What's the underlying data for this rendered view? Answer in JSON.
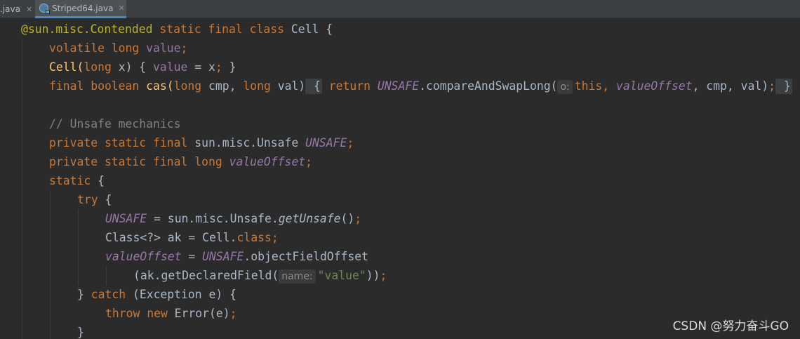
{
  "tabs": [
    {
      "label": ".java",
      "active": false
    },
    {
      "label": "Striped64.java",
      "active": true
    }
  ],
  "code": {
    "line1": {
      "annotation": "@sun.misc.Contended",
      "kw": " static final class",
      "rest": " Cell {"
    },
    "line2": {
      "kw": "volatile long",
      "field": " value",
      "semi": ";"
    },
    "line3": {
      "name": "Cell(",
      "kw": "long",
      "params": " x) { ",
      "field": "value",
      "rest": " = x",
      "semi": ";",
      "end": " }"
    },
    "line4": {
      "kw1": "final boolean",
      "name": " cas(",
      "kw2": "long",
      "p1": " cmp, ",
      "kw3": "long",
      "p2": " val)",
      "fold_open": " {",
      "kw4": " return",
      "sp": " ",
      "unsafe": "UNSAFE",
      "call": ".compareAndSwapLong(",
      "hint": "o:",
      "this_kw": "this",
      "comma": ", ",
      "offset": "valueOffset",
      "tail": ", cmp, val)",
      "semi": ";",
      "fold_close": " }"
    },
    "line5": {
      "comment": "// Unsafe mechanics"
    },
    "line6": {
      "kw": "private static final",
      "type": " sun.misc.Unsafe ",
      "field": "UNSAFE",
      "semi": ";"
    },
    "line7": {
      "kw": "private static final long",
      "sp": " ",
      "field": "valueOffset",
      "semi": ";"
    },
    "line8": {
      "kw": "static",
      "rest": " {"
    },
    "line9": {
      "kw": "try",
      "rest": " {"
    },
    "line10": {
      "field": "UNSAFE",
      "mid": " = sun.misc.Unsafe.",
      "method": "getUnsafe",
      "paren": "()",
      "semi": ";"
    },
    "line11": {
      "type": "Class<?> ak = Cell.",
      "kw": "class",
      "semi": ";"
    },
    "line12": {
      "field": "valueOffset",
      "mid": " = ",
      "unsafe": "UNSAFE",
      "call": ".objectFieldOffset"
    },
    "line13": {
      "call": "(ak.getDeclaredField(",
      "hint": "name:",
      "str": "\"value\"",
      "close": "))",
      "semi": ";"
    },
    "line14": {
      "brace": "} ",
      "kw": "catch",
      "rest": " (Exception e) {"
    },
    "line15": {
      "kw": "throw new",
      "rest": " Error(e)",
      "semi": ";"
    },
    "line16": {
      "brace": "}"
    }
  },
  "watermark": "CSDN @努力奋斗GO",
  "colors": {
    "background": "#2b2b2b",
    "keyword": "#cc7832",
    "annotation": "#bbb529",
    "field": "#9876aa",
    "string": "#6a8759",
    "comment": "#808080",
    "text": "#a9b7c6"
  }
}
